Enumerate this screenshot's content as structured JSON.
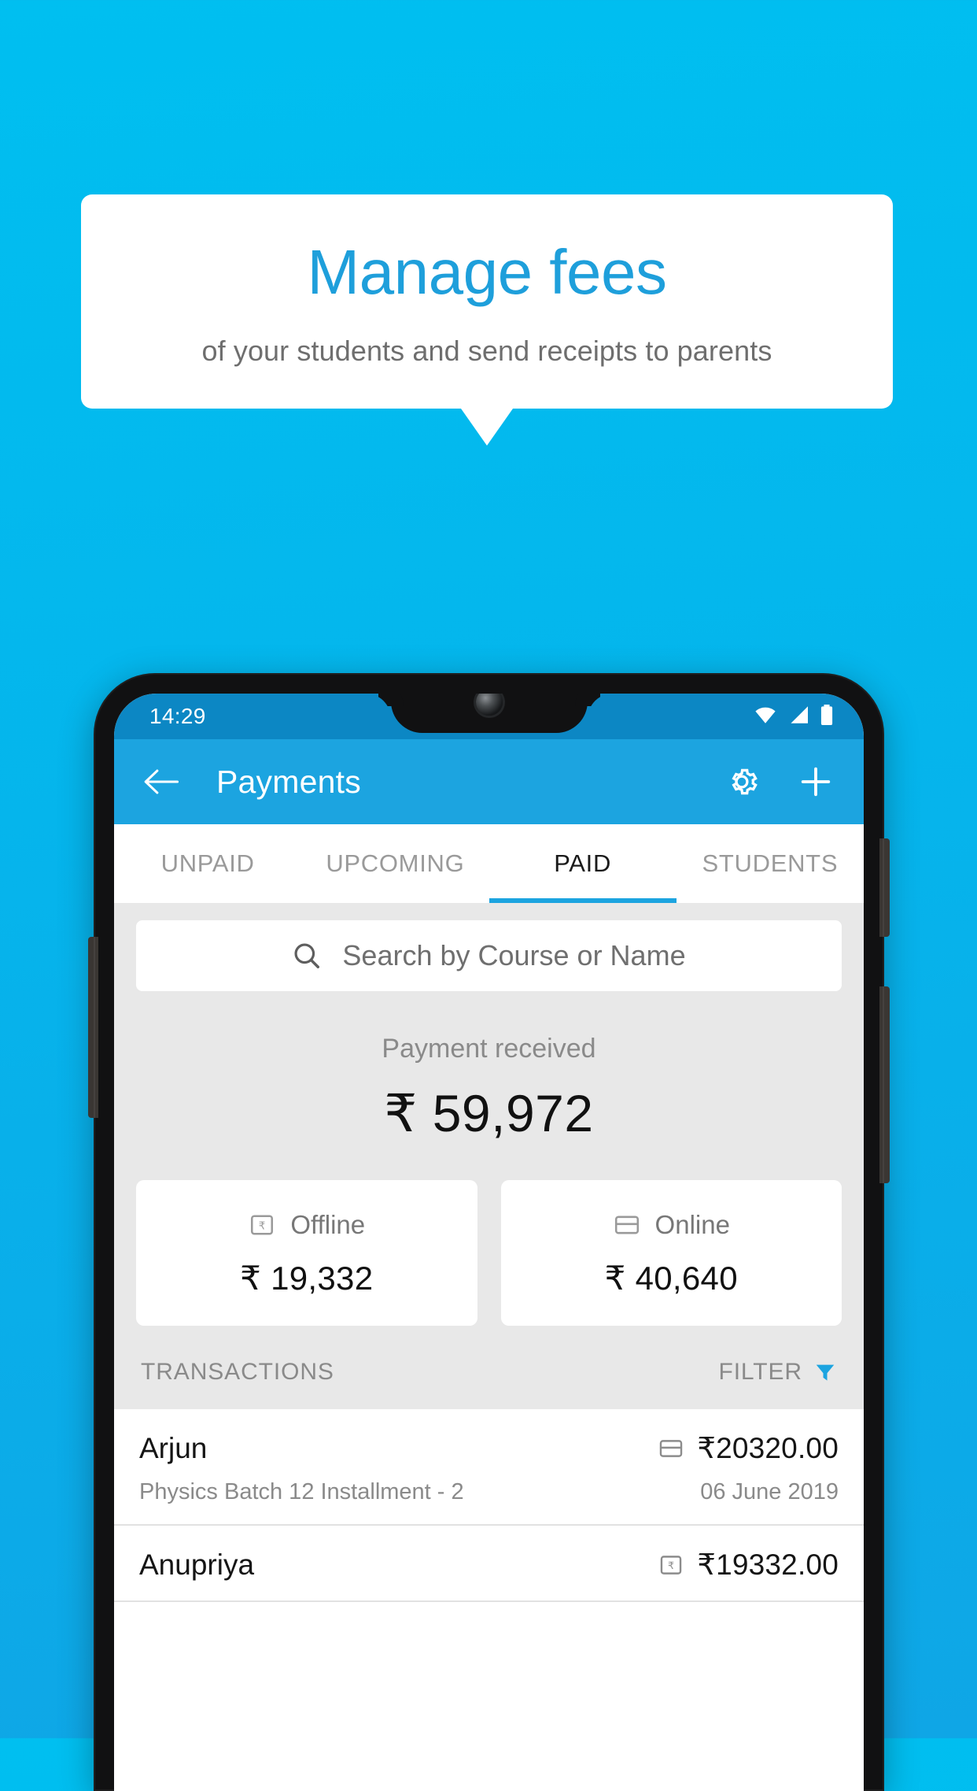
{
  "promo": {
    "title": "Manage fees",
    "subtitle": "of your students and send receipts to parents",
    "title_color": "#1E9FDB",
    "background_color": "#00BFF0"
  },
  "phone": {
    "status_bar": {
      "time": "14:29",
      "icons": [
        "wifi-icon",
        "signal-icon",
        "battery-icon"
      ]
    },
    "app_bar": {
      "back_icon": "back-arrow-icon",
      "title": "Payments",
      "settings_icon": "gear-icon",
      "add_icon": "plus-icon",
      "color": "#1CA4E0"
    },
    "tabs": [
      {
        "label": "UNPAID",
        "active": false
      },
      {
        "label": "UPCOMING",
        "active": false
      },
      {
        "label": "PAID",
        "active": true
      },
      {
        "label": "STUDENTS",
        "active": false
      }
    ],
    "search": {
      "icon": "search-icon",
      "placeholder": "Search by Course or Name",
      "value": ""
    },
    "summary": {
      "label": "Payment received",
      "amount": "₹ 59,972",
      "cards": [
        {
          "icon": "rupee-receipt-icon",
          "label": "Offline",
          "amount": "₹ 19,332"
        },
        {
          "icon": "credit-card-icon",
          "label": "Online",
          "amount": "₹ 40,640"
        }
      ]
    },
    "transactions_header": {
      "title": "TRANSACTIONS",
      "filter_label": "FILTER",
      "filter_icon": "funnel-icon",
      "filter_icon_color": "#1CA4E0"
    },
    "transactions": [
      {
        "name": "Arjun",
        "icon": "credit-card-icon",
        "amount": "₹20320.00",
        "subtitle": "Physics Batch 12 Installment - 2",
        "date": "06 June 2019"
      },
      {
        "name": "Anupriya",
        "icon": "rupee-receipt-icon",
        "amount": "₹19332.00",
        "subtitle": "",
        "date": ""
      }
    ]
  }
}
